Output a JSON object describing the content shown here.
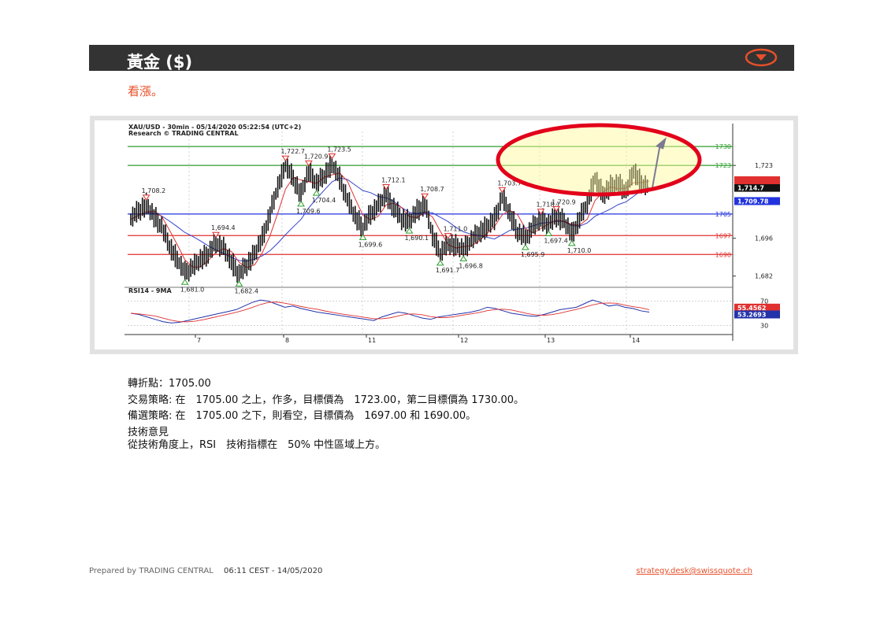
{
  "header": {
    "title": "黃金 ($)"
  },
  "subtitle": "看漲。",
  "colors": {
    "accent": "#e8502a",
    "header_bg": "#333333",
    "callout_ring": "#e2001a"
  },
  "chart_data": {
    "type": "candlestick",
    "title": "XAU/USD - 30min - 05/14/2020 05:22:54 (UTC+2)",
    "subtitle": "Research © TRADING CENTRAL",
    "x_tick_labels": [
      "7",
      "8",
      "11",
      "12",
      "13",
      "14"
    ],
    "price_axis_labels": [
      "1,723",
      "1,696",
      "1,682"
    ],
    "ylim": [
      1679,
      1735
    ],
    "current_price_tags": [
      "1,714.7",
      "1,709.78"
    ],
    "horizontal_levels": [
      {
        "value": 1730,
        "label": "1730",
        "color": "#2e9e2e"
      },
      {
        "value": 1723,
        "label": "1723",
        "color": "#2e9e2e"
      },
      {
        "value": 1705,
        "label": "1705",
        "color": "#2233dd"
      },
      {
        "value": 1697,
        "label": "1697",
        "color": "#e03030"
      },
      {
        "value": 1690,
        "label": "1690",
        "color": "#e03030"
      }
    ],
    "price_path": [
      1703,
      1706,
      1708.2,
      1704,
      1700,
      1693,
      1688,
      1683,
      1685,
      1688,
      1690,
      1694.4,
      1692,
      1687,
      1682.4,
      1686,
      1690,
      1696,
      1705,
      1715,
      1722.7,
      1718,
      1712,
      1720.9,
      1716,
      1719,
      1723.5,
      1718,
      1710,
      1704,
      1699.6,
      1705,
      1708,
      1712.1,
      1707,
      1703,
      1702,
      1706,
      1708.7,
      1697,
      1690.1,
      1694,
      1693,
      1691.7,
      1695,
      1698,
      1700,
      1703,
      1711,
      1705,
      1698,
      1695.9,
      1700,
      1703,
      1701,
      1704,
      1702,
      1697.4,
      1703,
      1709,
      1718.1,
      1712,
      1715,
      1716,
      1713,
      1720.9,
      1716,
      1714.7
    ],
    "peak_labels": [
      "1,708.2",
      "1,694.4",
      "1,722.7",
      "1,720.9",
      "1,723.5",
      "1,712.1",
      "1,708.7",
      "1,711.0",
      "1,703.7",
      "1,718.1",
      "1,720.9"
    ],
    "trough_labels": [
      "1,681.0",
      "1,682.4",
      "1,709.6",
      "1,704.4",
      "1,699.6",
      "1,690.1",
      "1,691.7",
      "1,696.8",
      "1,695.9",
      "1,697.4",
      "1,710.0"
    ],
    "rsi": {
      "label": "RSI14 - 9MA",
      "levels": [
        "70",
        "30"
      ],
      "current_tags": [
        "55.4562",
        "53.2693"
      ],
      "ylim": [
        20,
        80
      ],
      "series": [
        50,
        48,
        44,
        40,
        36,
        34,
        35,
        38,
        41,
        44,
        47,
        50,
        53,
        56,
        62,
        68,
        72,
        70,
        65,
        60,
        62,
        58,
        55,
        52,
        50,
        48,
        46,
        44,
        42,
        40,
        38,
        44,
        48,
        52,
        50,
        46,
        42,
        40,
        44,
        46,
        48,
        50,
        52,
        55,
        60,
        58,
        54,
        50,
        48,
        46,
        45,
        48,
        52,
        56,
        58,
        60,
        66,
        72,
        68,
        62,
        64,
        60,
        58,
        54,
        52
      ]
    }
  },
  "text": {
    "pivot": "轉折點：1705.00",
    "strategy": "交易策略: 在　1705.00 之上，作多，目標價為　1723.00，第二目標價為 1730.00。",
    "alternative": "備選策略: 在　1705.00 之下，則看空，目標價為　1697.00 和 1690.00。",
    "opinion_heading": "技術意見",
    "opinion": "從技術角度上，RSI　技術指標在　50% 中性區域上方。"
  },
  "footer": {
    "prepared_by": "Prepared by TRADING CENTRAL",
    "timestamp": "06:11 CEST - 14/05/2020",
    "email": "strategy.desk@swissquote.ch"
  }
}
